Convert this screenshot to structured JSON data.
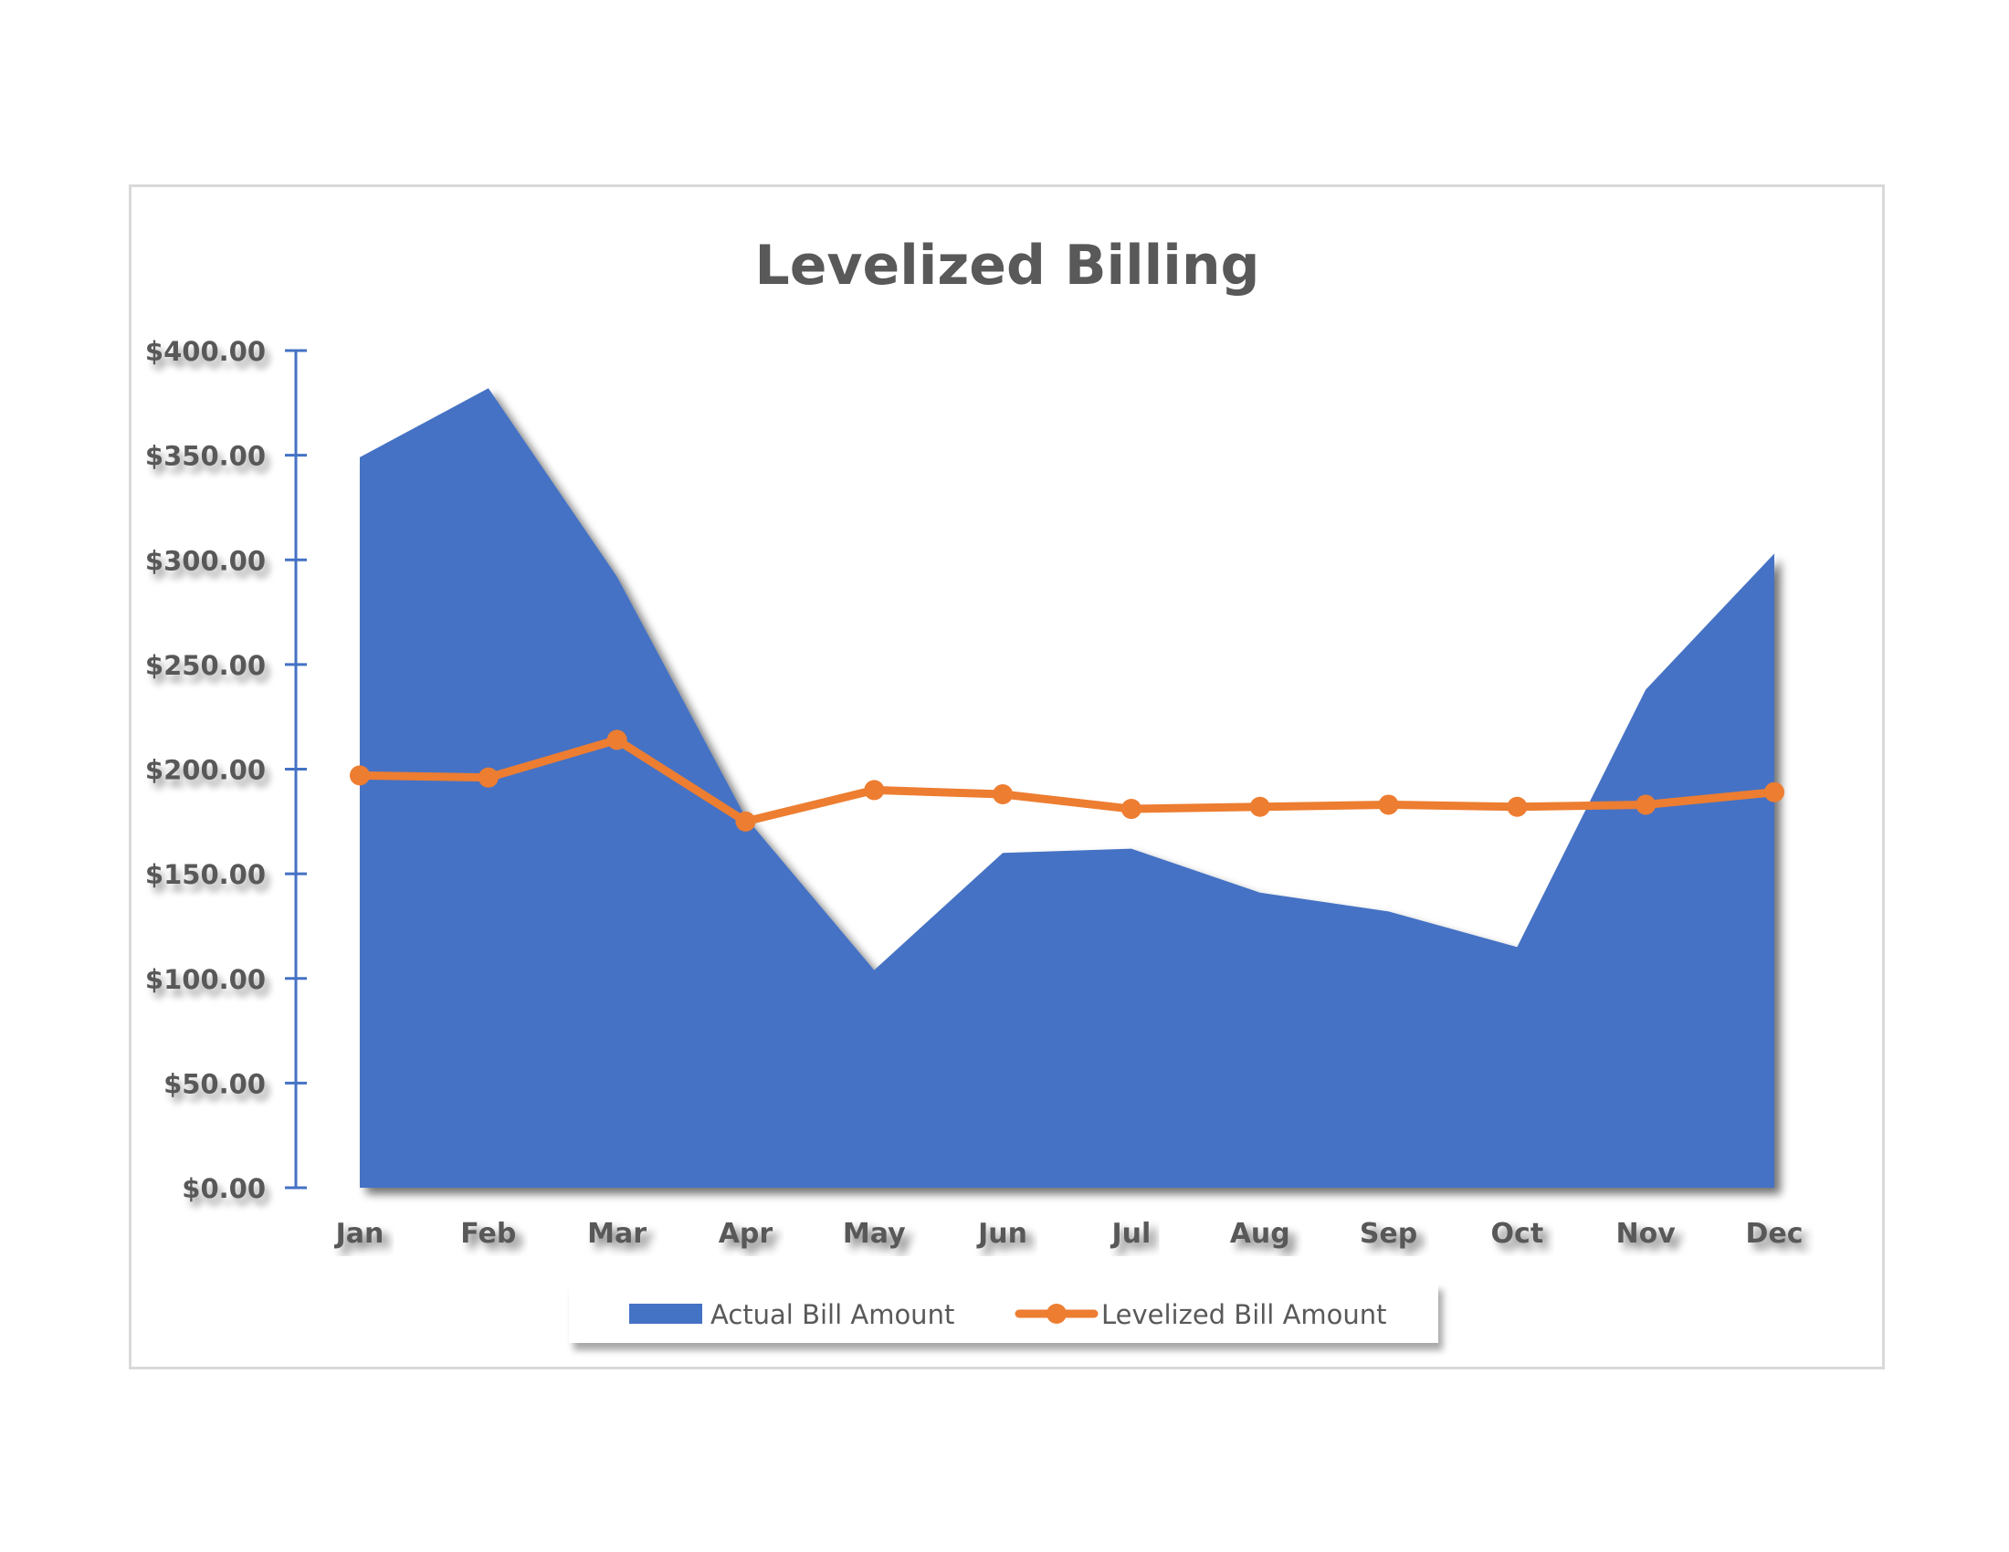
{
  "chart_data": {
    "type": "area",
    "title": "Levelized Billing",
    "xlabel": "",
    "ylabel": "",
    "categories": [
      "Jan",
      "Feb",
      "Mar",
      "Apr",
      "May",
      "Jun",
      "Jul",
      "Aug",
      "Sep",
      "Oct",
      "Nov",
      "Dec"
    ],
    "ylim": [
      0,
      400
    ],
    "y_ticks": [
      0,
      50,
      100,
      150,
      200,
      250,
      300,
      350,
      400
    ],
    "y_tick_labels": [
      "$0.00",
      "$50.00",
      "$100.00",
      "$150.00",
      "$200.00",
      "$250.00",
      "$300.00",
      "$350.00",
      "$400.00"
    ],
    "grid": true,
    "legend_position": "bottom",
    "series": [
      {
        "name": "Actual Bill Amount",
        "kind": "area",
        "color": "#4472C4",
        "values": [
          349,
          382,
          292,
          177,
          104,
          160,
          162,
          141,
          132,
          115,
          238,
          303
        ]
      },
      {
        "name": "Levelized Bill Amount",
        "kind": "line-markers",
        "color": "#ED7D31",
        "values": [
          197,
          196,
          214,
          175,
          190,
          188,
          181,
          182,
          183,
          182,
          183,
          189
        ]
      }
    ]
  },
  "colors": {
    "text": "#595959",
    "axis": "#4472C4",
    "grid": "#d9d9d9",
    "frame": "#d9d9d9"
  }
}
